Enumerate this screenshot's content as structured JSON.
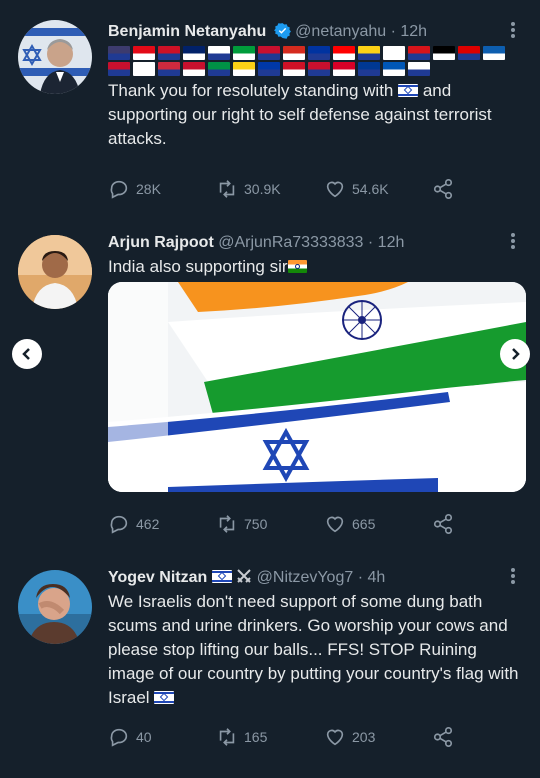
{
  "tweets": [
    {
      "name": "Benjamin Netanyahu",
      "handle": "@netanyahu",
      "time": "· 12h",
      "flag_colors": [
        "#3c3b6e",
        "#e30a17",
        "#ce1126",
        "#012169",
        "#ffffff",
        "#009c3b",
        "#c8102e",
        "#d52b1e",
        "#0033a0",
        "#ff0000",
        "#fcd116",
        "#ffffff",
        "#d7141a",
        "#000000",
        "#dd0000",
        "#0d5eaf",
        "#c8102e",
        "#ffffff",
        "#cd2a3e",
        "#c8102e",
        "#009246",
        "#fcd116",
        "#0038a8",
        "#ce1126",
        "#c8102e",
        "#d80027",
        "#003893",
        "#0057b7",
        "#ffffff"
      ],
      "text_1": "Thank you for resolutely standing with",
      "text_2": "and supporting our right to self defense against terrorist attacks.",
      "replies": "28K",
      "retweets": "30.9K",
      "likes": "54.6K"
    },
    {
      "name": "Arjun Rajpoot",
      "handle": "@ArjunRa73333833",
      "time": "· 12h",
      "text": "India also supporting sir",
      "replies": "462",
      "retweets": "750",
      "likes": "665"
    },
    {
      "name": "Yogev Nitzan",
      "handle": "@NitzevYog7",
      "time": "· 4h",
      "text": "We Israelis don't need support of some dung bath scums and urine drinkers. Go worship your cows and please stop lifting our balls... FFS! STOP Ruining image of our country by putting your country's flag with Israel",
      "replies": "40",
      "retweets": "165",
      "likes": "203"
    }
  ],
  "colors": {
    "background": "#15202b",
    "text": "#e7e9ea",
    "muted": "#8b98a5",
    "verified": "#1d9bf0"
  }
}
